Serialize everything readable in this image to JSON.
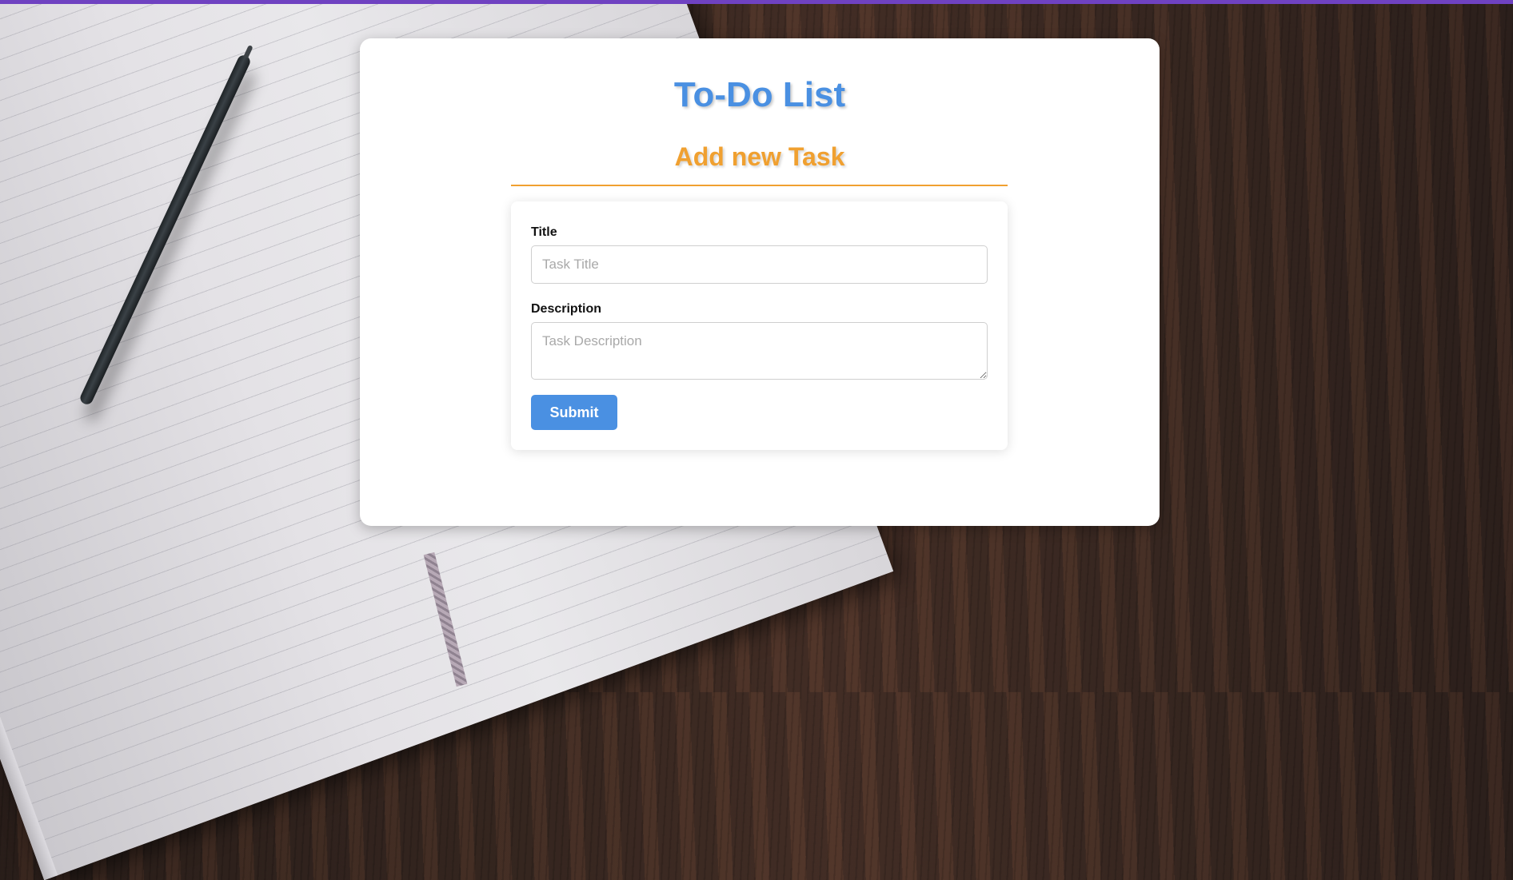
{
  "app": {
    "title": "To-Do List",
    "section_title": "Add new Task"
  },
  "form": {
    "title_label": "Title",
    "title_placeholder": "Task Title",
    "title_value": "",
    "description_label": "Description",
    "description_placeholder": "Task Description",
    "description_value": "",
    "submit_label": "Submit"
  },
  "colors": {
    "accent_blue": "#4a90e2",
    "accent_orange": "#f0a030",
    "top_bar": "#6f42c1"
  }
}
